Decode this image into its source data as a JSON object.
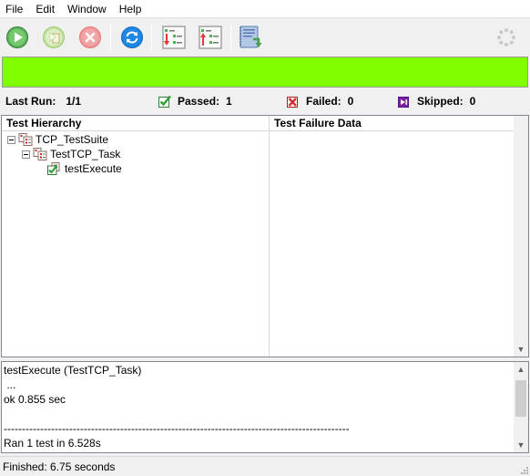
{
  "menu": {
    "file": "File",
    "edit": "Edit",
    "window": "Window",
    "help": "Help"
  },
  "toolbar": {
    "buttons": [
      {
        "icon": "run-icon",
        "color": "#4caf2a"
      },
      {
        "icon": "run-selected-icon",
        "color": "#9bcf67"
      },
      {
        "icon": "stop-icon",
        "color": "#e57373"
      },
      {
        "icon": "refresh-icon",
        "color": "#1e88e5"
      },
      {
        "icon": "expand-tree-icon"
      },
      {
        "icon": "collapse-tree-icon"
      },
      {
        "icon": "save-log-icon"
      },
      {
        "icon": "busy-spinner-icon"
      }
    ]
  },
  "progress": {
    "value": 1.0,
    "color": "#7fff00"
  },
  "stats": {
    "last_run_label": "Last Run:",
    "last_run_value": "1/1",
    "passed_label": "Passed:",
    "passed_value": "1",
    "failed_label": "Failed:",
    "failed_value": "0",
    "skipped_label": "Skipped:",
    "skipped_value": "0",
    "colors": {
      "passed": "#2e9e2e",
      "failed": "#d32f2f",
      "skipped": "#7b1fa2"
    }
  },
  "panes": {
    "hierarchy_header": "Test Hierarchy",
    "failure_header": "Test Failure Data",
    "tree": [
      {
        "label": "TCP_TestSuite",
        "level": 0,
        "expanded": true,
        "icon": "suite-icon"
      },
      {
        "label": "TestTCP_Task",
        "level": 1,
        "expanded": true,
        "icon": "suite-icon"
      },
      {
        "label": "testExecute",
        "level": 2,
        "icon": "test-passed-icon"
      }
    ]
  },
  "output": {
    "lines": [
      "testExecute (TestTCP_Task)",
      " ...",
      "ok 0.855 sec",
      "",
      "-----------------------------------------------------------------------------------------------",
      "Ran 1 test in 6.528s"
    ]
  },
  "status": {
    "text": "Finished: 6.75 seconds"
  }
}
